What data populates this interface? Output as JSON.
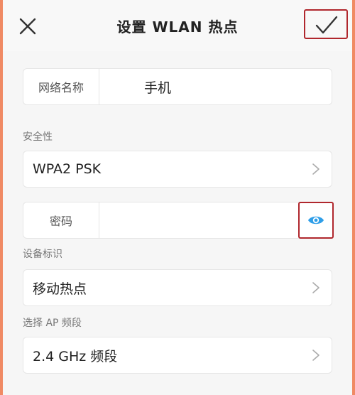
{
  "header": {
    "title": "设置 WLAN 热点",
    "close_icon": "close-icon",
    "confirm_icon": "checkmark-icon"
  },
  "network_name": {
    "label": "网络名称",
    "value": "手机"
  },
  "security": {
    "section_label": "安全性",
    "value": "WPA2 PSK"
  },
  "password": {
    "label": "密码",
    "value": "",
    "toggle_icon": "eye-icon"
  },
  "device_id": {
    "section_label": "设备标识",
    "value": "移动热点"
  },
  "ap_band": {
    "section_label": "选择 AP 频段",
    "value": "2.4 GHz 频段"
  },
  "colors": {
    "highlight_border": "#b0272d",
    "eye_icon": "#2f9ee8",
    "frame": "#f08a64"
  }
}
